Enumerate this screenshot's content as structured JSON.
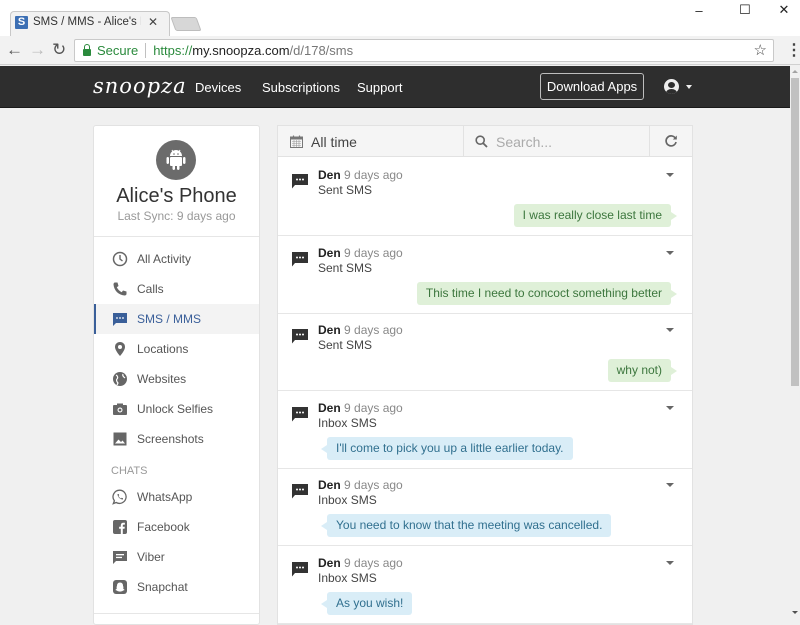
{
  "browser": {
    "tab_title": "SMS / MMS - Alice's Phone",
    "tab_title_visible": "SMS / MMS - Alice's Phor",
    "favicon_letter": "S",
    "security_label": "Secure",
    "url_protocol": "https://",
    "url_host": "my.snoopza.com",
    "url_path": "/d/178/sms",
    "window_controls": {
      "minimize": "–",
      "maximize": "☐",
      "close": "✕"
    }
  },
  "header": {
    "logo": "snoopza",
    "nav": [
      {
        "label": "Devices"
      },
      {
        "label": "Subscriptions"
      },
      {
        "label": "Support"
      }
    ],
    "download_button": "Download Apps",
    "account_icon": "user-circle-icon"
  },
  "device": {
    "name": "Alice's Phone",
    "last_sync": "Last Sync: 9 days ago",
    "platform_icon": "android-icon"
  },
  "sidebar": {
    "items": [
      {
        "label": "All Activity",
        "icon": "clock-icon",
        "active": false
      },
      {
        "label": "Calls",
        "icon": "phone-icon",
        "active": false
      },
      {
        "label": "SMS / MMS",
        "icon": "message-icon",
        "active": true
      },
      {
        "label": "Locations",
        "icon": "map-pin-icon",
        "active": false
      },
      {
        "label": "Websites",
        "icon": "globe-icon",
        "active": false
      },
      {
        "label": "Unlock Selfies",
        "icon": "camera-icon",
        "active": false
      },
      {
        "label": "Screenshots",
        "icon": "image-icon",
        "active": false
      }
    ],
    "chats_header": "CHATS",
    "chats": [
      {
        "label": "WhatsApp",
        "icon": "whatsapp-icon"
      },
      {
        "label": "Facebook",
        "icon": "facebook-icon"
      },
      {
        "label": "Viber",
        "icon": "viber-icon"
      },
      {
        "label": "Snapchat",
        "icon": "snapchat-icon"
      }
    ]
  },
  "toolbar": {
    "date_range": "All time",
    "search_placeholder": "Search...",
    "search_value": ""
  },
  "colors": {
    "header_bg": "#2e2e2e",
    "active_accent": "#3a5f99",
    "sent_bubble": "#dff0d8",
    "inbox_bubble": "#d9edf7"
  },
  "messages": [
    {
      "sender": "Den",
      "time": "9 days ago",
      "type": "Sent SMS",
      "direction": "sent",
      "text": "I was really close last time"
    },
    {
      "sender": "Den",
      "time": "9 days ago",
      "type": "Sent SMS",
      "direction": "sent",
      "text": "This time I need to concoct something better"
    },
    {
      "sender": "Den",
      "time": "9 days ago",
      "type": "Sent SMS",
      "direction": "sent",
      "text": "why not)"
    },
    {
      "sender": "Den",
      "time": "9 days ago",
      "type": "Inbox SMS",
      "direction": "inbox",
      "text": "I'll come to pick you up a little earlier today."
    },
    {
      "sender": "Den",
      "time": "9 days ago",
      "type": "Inbox SMS",
      "direction": "inbox",
      "text": "You need to know that the meeting was cancelled."
    },
    {
      "sender": "Den",
      "time": "9 days ago",
      "type": "Inbox SMS",
      "direction": "inbox",
      "text": "As you wish!"
    }
  ]
}
